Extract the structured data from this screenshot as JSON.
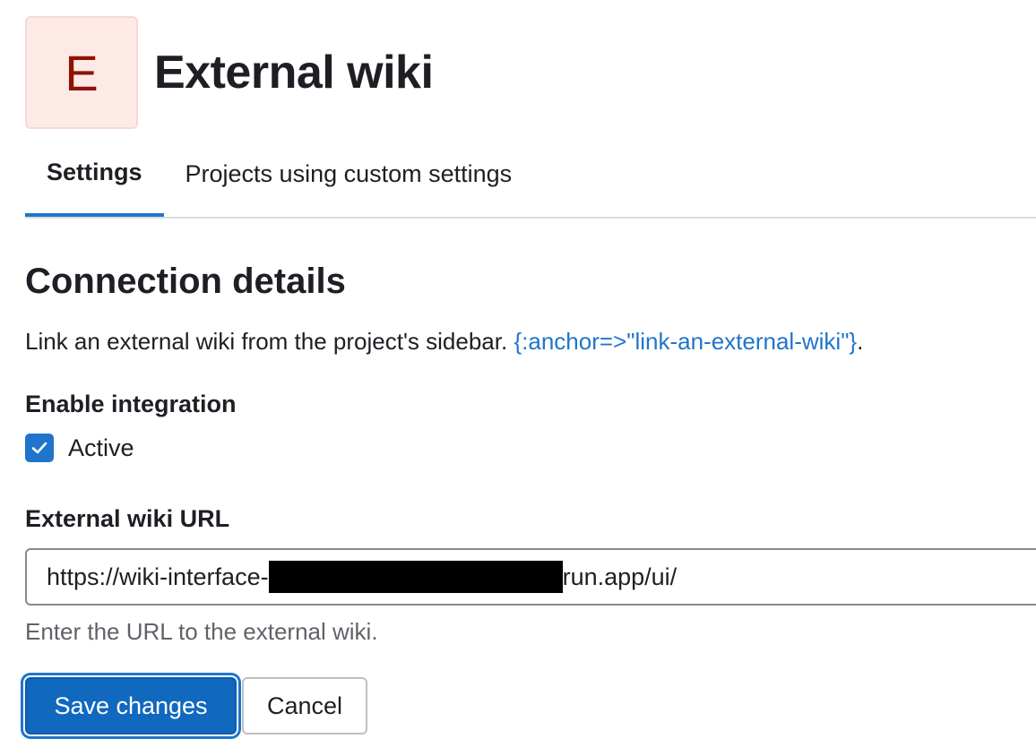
{
  "header": {
    "avatar_letter": "E",
    "title": "External wiki"
  },
  "tabs": [
    {
      "label": "Settings",
      "active": true
    },
    {
      "label": "Projects using custom settings",
      "active": false
    }
  ],
  "section": {
    "title": "Connection details",
    "description": "Link an external wiki from the project's sidebar. ",
    "link_text": "{:anchor=>\"link-an-external-wiki\"}",
    "description_end": "."
  },
  "enable_integration": {
    "label": "Enable integration",
    "checkbox_label": "Active",
    "checked": true
  },
  "url_field": {
    "label": "External wiki URL",
    "value_prefix": "https://wiki-interface-",
    "value_suffix": "run.app/ui/",
    "help_text": "Enter the URL to the external wiki."
  },
  "actions": {
    "save_label": "Save changes",
    "cancel_label": "Cancel"
  },
  "colors": {
    "accent": "#1f75cb",
    "primary_button": "#1068bf",
    "avatar_bg": "#fdeae7",
    "avatar_text": "#8d1300"
  }
}
